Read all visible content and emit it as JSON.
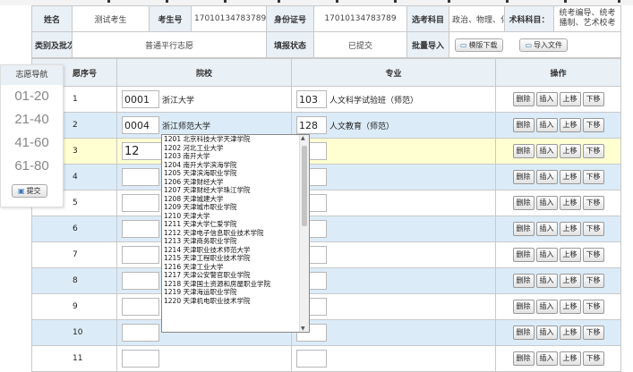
{
  "info": {
    "name_label": "姓名",
    "name_value": "测试考生",
    "exam_no_label": "考生号",
    "exam_no_value": "17010134783789",
    "id_label": "身份证号",
    "id_value": "17010134783789",
    "subjects_label": "选考科目",
    "subjects_value": "政治、物理、化学",
    "tech_label": "术科科目：",
    "tech_value": "统考编导、统考播制、艺术校考",
    "batch_label": "类别及批次",
    "batch_value": "普通平行志愿",
    "status_label": "填报状态",
    "status_value": "已提交",
    "import_label": "批量导入",
    "template_btn": "模版下载",
    "import_btn": "导入文件"
  },
  "table": {
    "headers": [
      "愿序号",
      "院校",
      "专业",
      "操作"
    ],
    "rows": [
      {
        "no": "1",
        "school_code": "0001",
        "school_name": "浙江大学",
        "major_code": "103",
        "major_name": "人文科学试验班（师范）"
      },
      {
        "no": "2",
        "school_code": "0004",
        "school_name": "浙江师范大学",
        "major_code": "128",
        "major_name": "人文教育（师范）"
      },
      {
        "no": "3",
        "school_code": "12",
        "school_name": "",
        "major_code": "",
        "major_name": ""
      },
      {
        "no": "4",
        "school_code": "",
        "school_name": "",
        "major_code": "",
        "major_name": ""
      },
      {
        "no": "5",
        "school_code": "",
        "school_name": "",
        "major_code": "",
        "major_name": ""
      },
      {
        "no": "6",
        "school_code": "",
        "school_name": "",
        "major_code": "",
        "major_name": ""
      },
      {
        "no": "7",
        "school_code": "",
        "school_name": "",
        "major_code": "",
        "major_name": ""
      },
      {
        "no": "8",
        "school_code": "",
        "school_name": "",
        "major_code": "",
        "major_name": ""
      },
      {
        "no": "9",
        "school_code": "",
        "school_name": "",
        "major_code": "",
        "major_name": ""
      },
      {
        "no": "10",
        "school_code": "",
        "school_name": "",
        "major_code": "",
        "major_name": ""
      },
      {
        "no": "11",
        "school_code": "",
        "school_name": "",
        "major_code": "",
        "major_name": ""
      }
    ],
    "actions": [
      "删除",
      "插入",
      "上移",
      "下移"
    ]
  },
  "sidebar": {
    "title": "志愿导航",
    "ranges": [
      "01-20",
      "21-40",
      "41-60",
      "61-80"
    ],
    "submit": "提交"
  },
  "dropdown": {
    "options": [
      "1201 北京科技大学天津学院",
      "1202 河北工业大学",
      "1203 南开大学",
      "1204 南开大学滨海学院",
      "1205 天津滨海职业学院",
      "1206 天津财经大学",
      "1207 天津财经大学珠江学院",
      "1208 天津城建大学",
      "1209 天津城市职业学院",
      "1210 天津大学",
      "1211 天津大学仁爱学院",
      "1212 天津电子信息职业技术学院",
      "1213 天津商务职业学院",
      "1214 天津职业技术师范大学",
      "1215 天津工程职业技术学院",
      "1216 天津工业大学",
      "1217 天津公安警官职业学院",
      "1218 天津国土资源和房屋职业学院",
      "1219 天津海运职业学院",
      "1220 天津机电职业技术学院"
    ]
  }
}
